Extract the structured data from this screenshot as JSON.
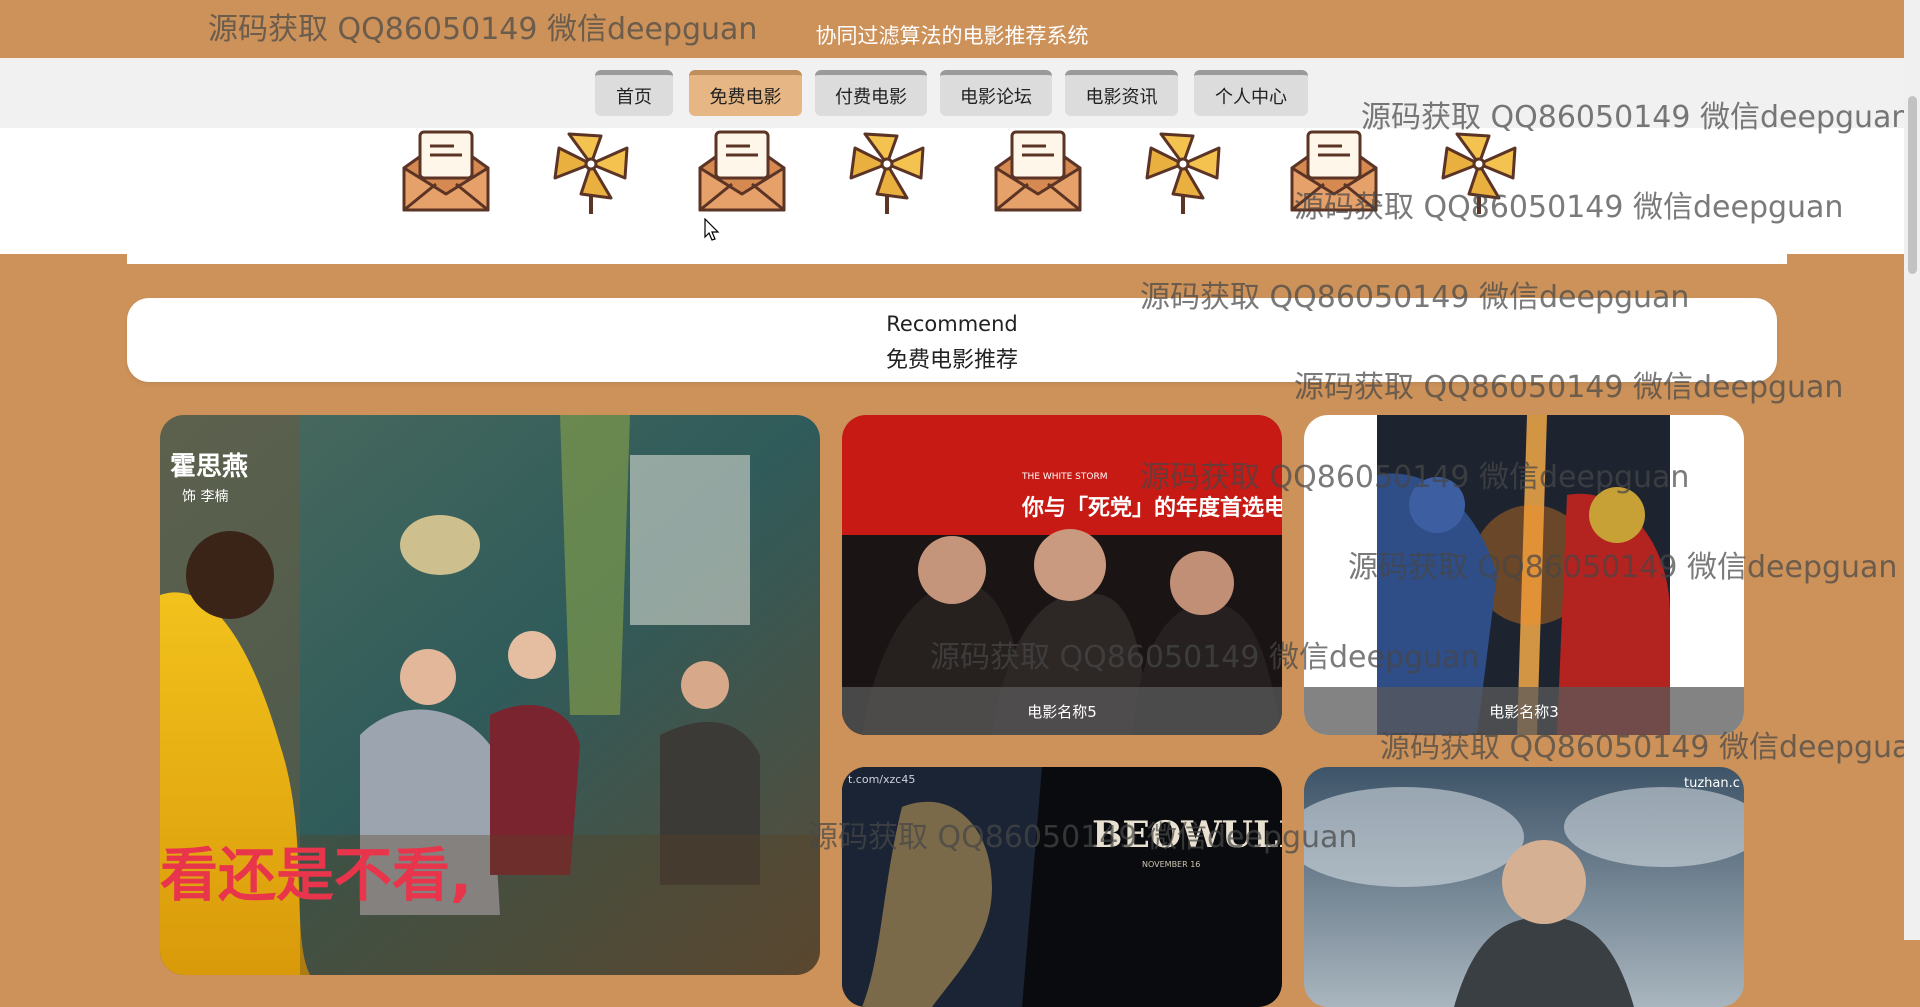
{
  "header": {
    "title": "协同过滤算法的电影推荐系统"
  },
  "nav": {
    "items": [
      {
        "label": "首页"
      },
      {
        "label": "免费电影"
      },
      {
        "label": "付费电影"
      },
      {
        "label": "电影论坛"
      },
      {
        "label": "电影资讯"
      },
      {
        "label": "个人中心"
      }
    ],
    "active_index": 1
  },
  "decor": {
    "icons": [
      "envelope-icon",
      "pinwheel-icon",
      "envelope-icon",
      "pinwheel-icon",
      "envelope-icon",
      "pinwheel-icon",
      "envelope-icon",
      "pinwheel-icon"
    ]
  },
  "recommend": {
    "title_en": "Recommend",
    "title_zh": "免费电影推荐"
  },
  "posters": {
    "large": {
      "caption": "",
      "texts": [
        "霍思燕",
        "饰 李楠",
        "看还是不看,"
      ]
    },
    "p5": {
      "caption": "电影名称5",
      "texts": [
        "THE WHITE STORM",
        "你与「死党」的年度首选电影"
      ]
    },
    "p3": {
      "caption": "电影名称3"
    },
    "p4": {
      "caption": "",
      "texts": [
        "BEOWULF",
        "NOVEMBER 16",
        "t.com/xzc45"
      ]
    },
    "p6": {
      "caption": "",
      "texts": [
        "tuzhan.c"
      ]
    }
  },
  "watermark": {
    "text": "源码获取 QQ86050149 微信deepguan"
  },
  "colors": {
    "brand": "#cd925a",
    "nav_active": "#e6b785"
  }
}
